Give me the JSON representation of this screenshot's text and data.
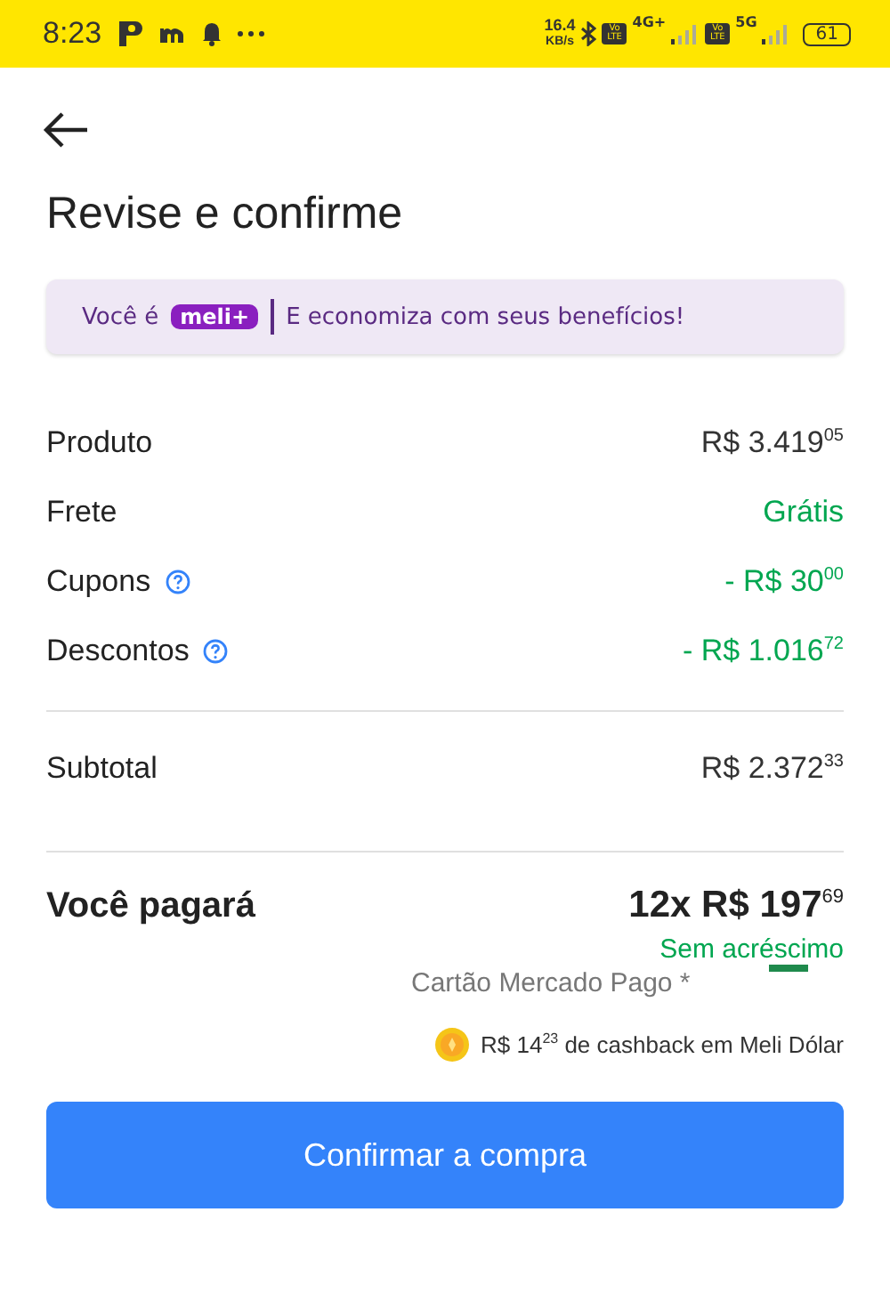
{
  "status_bar": {
    "time": "8:23",
    "speed": "16.4",
    "speed_unit": "KB/s",
    "volte_1": "Vo LTE",
    "volte_2": "Vo LTE",
    "network_1": "4G+",
    "network_2": "5G",
    "battery": "61"
  },
  "title": "Revise e confirme",
  "banner": {
    "prefix": "Você é",
    "badge": "meli+",
    "text": "E economiza com seus benefícios!"
  },
  "summary": [
    {
      "label": "Produto",
      "value": "R$ 3.419$^{05}$",
      "kind": "charge",
      "help": false
    },
    {
      "label": "Frete",
      "value": "Grátis",
      "kind": "discount",
      "help": false
    },
    {
      "label": "Cupons",
      "value": "- R$ 30$^{00}$",
      "kind": "discount",
      "help": true
    },
    {
      "label": "Descontos",
      "value": "- R$ 1.016$^{72}$",
      "kind": "discount",
      "help": true
    }
  ],
  "subtotal": {
    "label": "Subtotal",
    "value": "R$ 2.372$^{33}$"
  },
  "total": {
    "label": "Você pagará",
    "value": "12x R$ 197$^{69}$",
    "note": "Sem acréscimo",
    "method": "Cartão Mercado Pago *",
    "cashback": "R$ 14$^{23}$ de cashback em Meli Dólar"
  },
  "button": "Confirmar a compra"
}
